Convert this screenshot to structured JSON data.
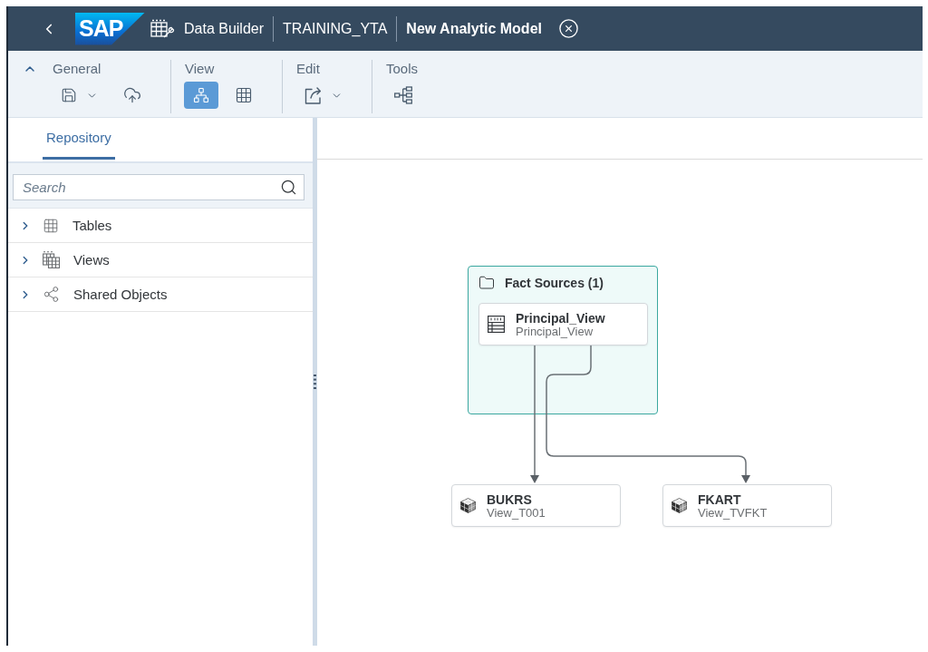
{
  "header": {
    "logo": "SAP",
    "breadcrumbs": [
      "Data Builder",
      "TRAINING_YTA"
    ],
    "title": "New Analytic Model"
  },
  "toolbar": {
    "expanded": true,
    "groups": [
      {
        "label": "General",
        "tools": [
          {
            "kind": "save",
            "dropdown": true,
            "selected": false
          },
          {
            "kind": "deploy",
            "dropdown": false,
            "selected": false
          }
        ]
      },
      {
        "label": "View",
        "tools": [
          {
            "kind": "diagram",
            "dropdown": false,
            "selected": true
          },
          {
            "kind": "table",
            "dropdown": false,
            "selected": false
          }
        ]
      },
      {
        "label": "Edit",
        "tools": [
          {
            "kind": "export",
            "dropdown": true,
            "selected": false
          }
        ]
      },
      {
        "label": "Tools",
        "tools": [
          {
            "kind": "tree",
            "dropdown": false,
            "selected": false
          }
        ]
      }
    ]
  },
  "sidebar": {
    "tabs": [
      {
        "label": "Repository",
        "selected": true
      }
    ],
    "search": {
      "placeholder": "Search"
    },
    "items": [
      {
        "label": "Tables",
        "kind": "tables",
        "expanded": false
      },
      {
        "label": "Views",
        "kind": "views",
        "expanded": false
      },
      {
        "label": "Shared Objects",
        "kind": "shared",
        "expanded": false
      }
    ]
  },
  "canvas": {
    "container": {
      "title": "Fact Sources (1)",
      "nodes": [
        {
          "title": "Principal_View",
          "subtitle": "Principal_View",
          "kind": "view"
        }
      ]
    },
    "nodes": [
      {
        "title": "BUKRS",
        "subtitle": "View_T001",
        "kind": "dimension",
        "linked": true
      },
      {
        "title": "FKART",
        "subtitle": "View_TVFKT",
        "kind": "dimension",
        "linked": true
      }
    ]
  }
}
